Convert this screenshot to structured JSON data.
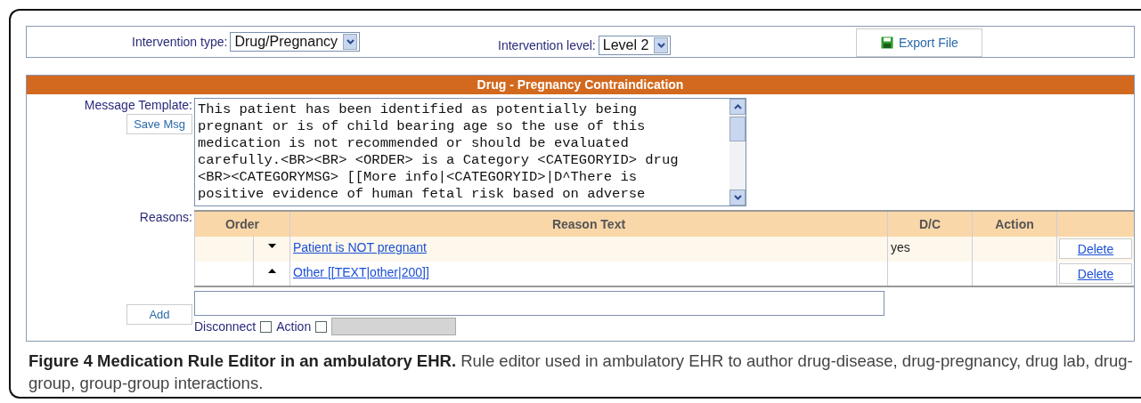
{
  "toolbar": {
    "type_label": "Intervention type:",
    "type_value": "Drug/Pregnancy",
    "level_label": "Intervention level:",
    "level_value": "Level 2",
    "export_button": "Export File"
  },
  "panel": {
    "title": "Drug - Pregnancy Contraindication",
    "message_label": "Message Template:",
    "save_button": "Save Msg",
    "message_lines": [
      "This patient has been identified as potentially being",
      "pregnant or is of child bearing age so the use of this",
      "medication is not recommended or should be evaluated",
      "carefully.<BR><BR> <ORDER> is a Category <CATEGORYID> drug",
      "<BR><CATEGORYMSG> [[More info|<CATEGORYID>|D^There is",
      "positive evidence of human fetal risk based on adverse"
    ],
    "reasons_label": "Reasons:",
    "columns": [
      "Order",
      "Reason Text",
      "D/C",
      "Action"
    ],
    "rows": [
      {
        "kind": "down",
        "text": "Patient is NOT pregnant",
        "dc": "yes",
        "delete": "Delete"
      },
      {
        "kind": "up",
        "text": "Other [[TEXT|other|200]]",
        "dc": "",
        "delete": "Delete"
      }
    ],
    "add_button": "Add",
    "disconnect_label": "Disconnect",
    "disconnect_checked": false,
    "action_label": "Action",
    "action_checked": false
  },
  "caption": "**Figure 4 Medication Rule Editor in an ambulatory EHR.** Rule editor used in ambulatory EHR to author drug-disease, drug-pregnancy, drug lab, drug-group, group-group interactions."
}
